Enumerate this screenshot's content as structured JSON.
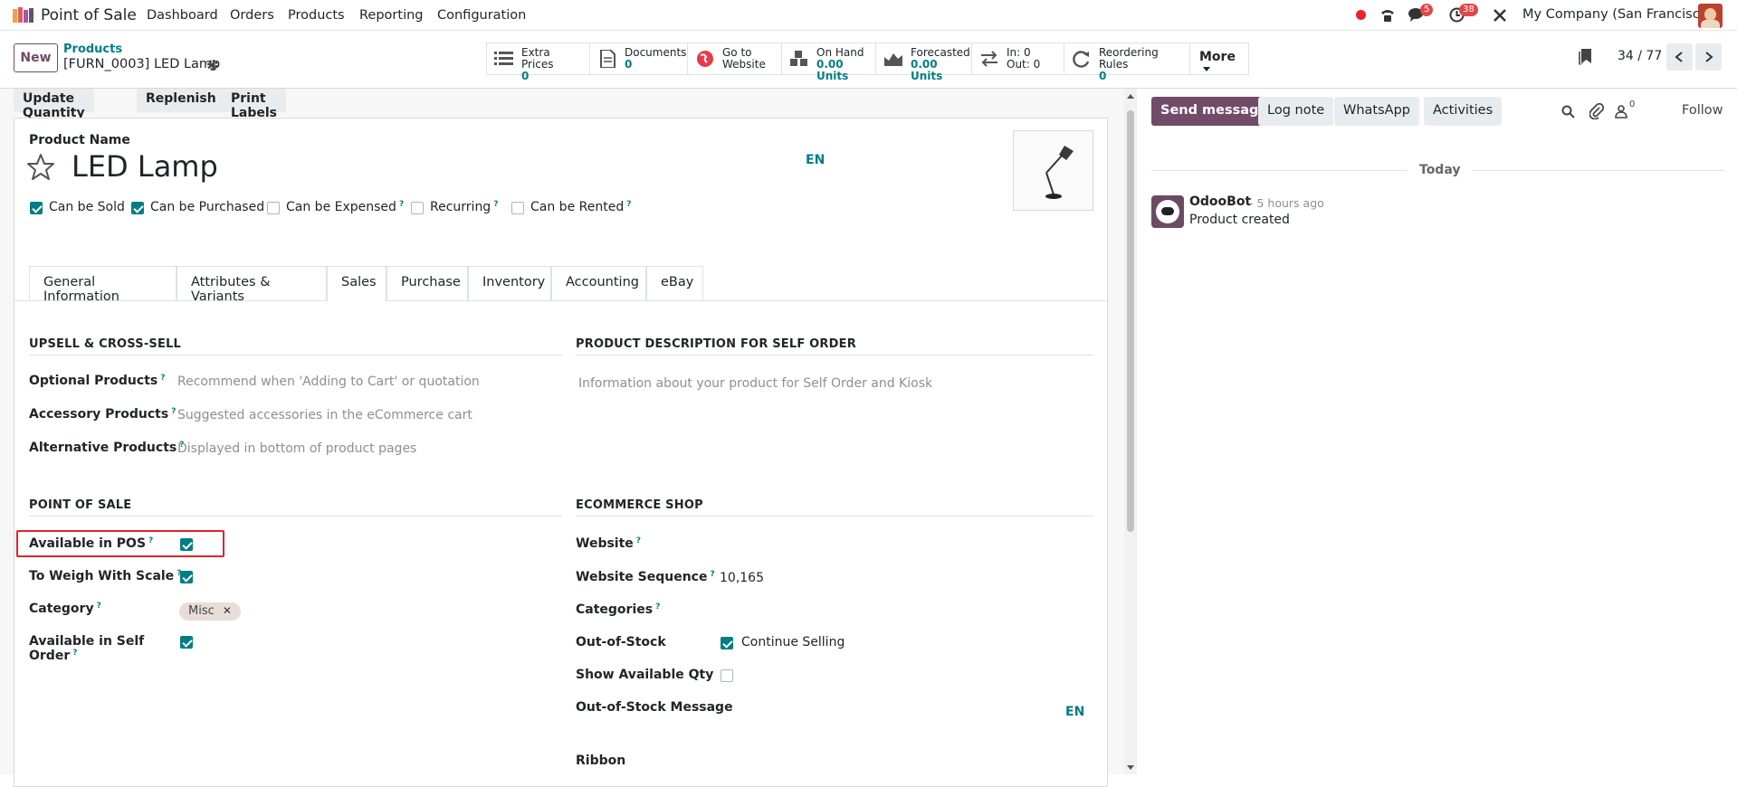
{
  "nav": {
    "app_name": "Point of Sale",
    "menus": [
      "Dashboard",
      "Orders",
      "Products",
      "Reporting",
      "Configuration"
    ],
    "chat_count": "5",
    "activity_count": "38",
    "company": "My Company (San Francisco)"
  },
  "control": {
    "new_label": "New",
    "breadcrumb_parent": "Products",
    "breadcrumb_current": "[FURN_0003] LED Lamp",
    "pager": "34 / 77",
    "smart_buttons": [
      {
        "label": "Extra Prices",
        "value": "0"
      },
      {
        "label": "Documents",
        "value": "0"
      },
      {
        "label": "Go to",
        "value": "Website"
      },
      {
        "label": "On Hand",
        "value": "0.00 Units"
      },
      {
        "label": "Forecasted",
        "value": "0.00 Units"
      },
      {
        "label": "In: 0",
        "value": "Out: 0"
      },
      {
        "label": "Reordering Rules",
        "value": "0"
      }
    ],
    "more_label": "More"
  },
  "status_buttons": [
    "Update Quantity",
    "Replenish",
    "Print Labels"
  ],
  "product": {
    "name_label": "Product Name",
    "name": "LED Lamp",
    "lang": "EN",
    "flags": [
      {
        "label": "Can be Sold",
        "checked": true,
        "help": ""
      },
      {
        "label": "Can be Purchased",
        "checked": true,
        "help": ""
      },
      {
        "label": "Can be Expensed",
        "checked": false,
        "help": "?"
      },
      {
        "label": "Recurring",
        "checked": false,
        "help": "?"
      },
      {
        "label": "Can be Rented",
        "checked": false,
        "help": "?"
      }
    ]
  },
  "tabs": [
    "General Information",
    "Attributes & Variants",
    "Sales",
    "Purchase",
    "Inventory",
    "Accounting",
    "eBay"
  ],
  "upsell": {
    "title": "UPSELL & CROSS-SELL",
    "fields": [
      {
        "label": "Optional Products",
        "placeholder": "Recommend when 'Adding to Cart' or quotation"
      },
      {
        "label": "Accessory Products",
        "placeholder": "Suggested accessories in the eCommerce cart"
      },
      {
        "label": "Alternative Products",
        "placeholder": "Displayed in bottom of product pages"
      }
    ]
  },
  "self_order": {
    "title": "PRODUCT DESCRIPTION FOR SELF ORDER",
    "placeholder": "Information about your product for Self Order and Kiosk"
  },
  "pos": {
    "title": "POINT OF SALE",
    "available_label": "Available in POS",
    "weigh_label": "To Weigh With Scale",
    "category_label": "Category",
    "category_value": "Misc",
    "self_order_label_1": "Available in Self",
    "self_order_label_2": "Order"
  },
  "ecommerce": {
    "title": "ECOMMERCE SHOP",
    "website_label": "Website",
    "sequence_label": "Website Sequence",
    "sequence_value": "10,165",
    "categories_label": "Categories",
    "oos_label": "Out-of-Stock",
    "continue_label": "Continue Selling",
    "show_qty_label": "Show Available Qty",
    "oos_message_label": "Out-of-Stock Message",
    "lang": "EN",
    "ribbon_label": "Ribbon"
  },
  "help_mark": "?",
  "chatter": {
    "send_message": "Send message",
    "log_note": "Log note",
    "whatsapp": "WhatsApp",
    "activities": "Activities",
    "followers": "0",
    "follow": "Follow",
    "date_sep": "Today",
    "author": "OdooBot",
    "time": "- 5 hours ago",
    "body": "Product created"
  }
}
